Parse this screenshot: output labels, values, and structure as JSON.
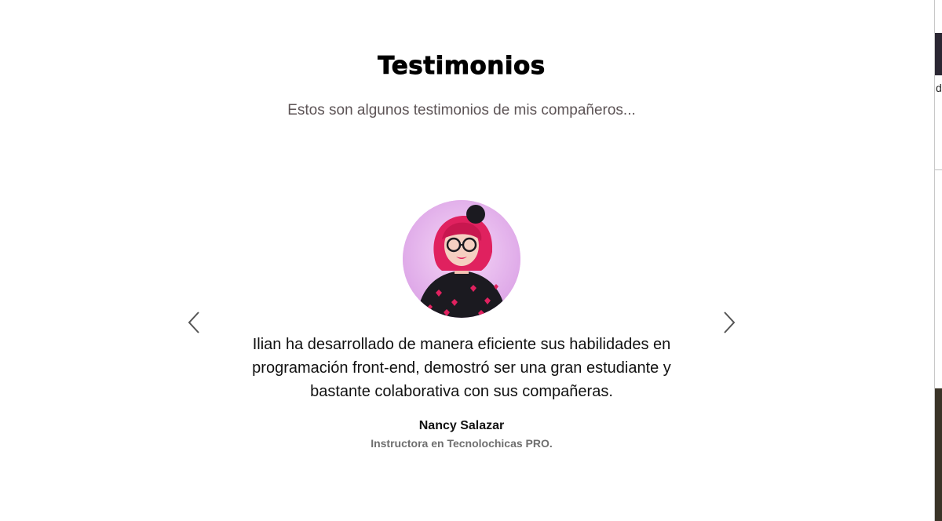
{
  "section": {
    "title": "Testimonios",
    "subtitle": "Estos son algunos testimonios de mis compañeros..."
  },
  "testimonial": {
    "quote": "Ilian ha desarrollado de manera eficiente sus habilidades en programación front-end, demostró ser una gran estudiante y bastante colaborativa con sus compañeras.",
    "author_name": "Nancy Salazar",
    "author_role": "Instructora en Tecnolochicas PRO.",
    "avatar_icon": "person-photo-avatar"
  },
  "controls": {
    "prev_icon": "chevron-left-icon",
    "next_icon": "chevron-right-icon"
  },
  "edge_window": {
    "visible_char": "d"
  },
  "colors": {
    "title": "#000000",
    "subtitle": "#5d5456",
    "quote": "#111111",
    "role": "#6f6f6f",
    "avatar_background": "#e9b4f0",
    "hair": "#e0215f"
  }
}
